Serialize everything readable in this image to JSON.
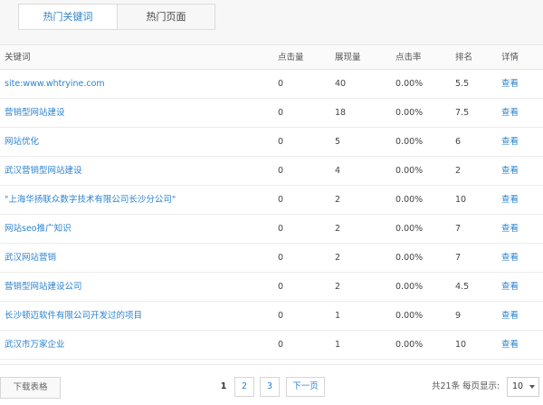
{
  "tabs": [
    {
      "label": "热门关键词",
      "active": true
    },
    {
      "label": "热门页面",
      "active": false
    }
  ],
  "table": {
    "headers": {
      "keyword": "关键词",
      "clicks": "点击量",
      "impressions": "展现量",
      "ctr": "点击率",
      "rank": "排名",
      "detail": "详情"
    },
    "rows": [
      {
        "keyword": "site:www.whtryine.com",
        "clicks": "0",
        "impressions": "40",
        "ctr": "0.00%",
        "rank": "5.5",
        "detail": "查看"
      },
      {
        "keyword": "营销型网站建设",
        "clicks": "0",
        "impressions": "18",
        "ctr": "0.00%",
        "rank": "7.5",
        "detail": "查看"
      },
      {
        "keyword": "网站优化",
        "clicks": "0",
        "impressions": "5",
        "ctr": "0.00%",
        "rank": "6",
        "detail": "查看"
      },
      {
        "keyword": "武汉营销型网站建设",
        "clicks": "0",
        "impressions": "4",
        "ctr": "0.00%",
        "rank": "2",
        "detail": "查看"
      },
      {
        "keyword": "\"上海华扬联众数字技术有限公司长沙分公司\"",
        "clicks": "0",
        "impressions": "2",
        "ctr": "0.00%",
        "rank": "10",
        "detail": "查看"
      },
      {
        "keyword": "网站seo推广知识",
        "clicks": "0",
        "impressions": "2",
        "ctr": "0.00%",
        "rank": "7",
        "detail": "查看"
      },
      {
        "keyword": "武汉网站营销",
        "clicks": "0",
        "impressions": "2",
        "ctr": "0.00%",
        "rank": "7",
        "detail": "查看"
      },
      {
        "keyword": "营销型网站建设公司",
        "clicks": "0",
        "impressions": "2",
        "ctr": "0.00%",
        "rank": "4.5",
        "detail": "查看"
      },
      {
        "keyword": "长沙顿迈软件有限公司开发过的项目",
        "clicks": "0",
        "impressions": "1",
        "ctr": "0.00%",
        "rank": "9",
        "detail": "查看"
      },
      {
        "keyword": "武汉市万家企业",
        "clicks": "0",
        "impressions": "1",
        "ctr": "0.00%",
        "rank": "10",
        "detail": "查看"
      }
    ]
  },
  "footer": {
    "export_label": "下载表格",
    "pages": [
      "1",
      "2",
      "3"
    ],
    "current_page": "1",
    "next_label": "下一页",
    "total_label": "共21条",
    "per_page_label": "每页显示:",
    "per_page_value": "10"
  },
  "colors": {
    "link": "#2c83cf",
    "text": "#444444",
    "border": "#e6e6e6"
  }
}
